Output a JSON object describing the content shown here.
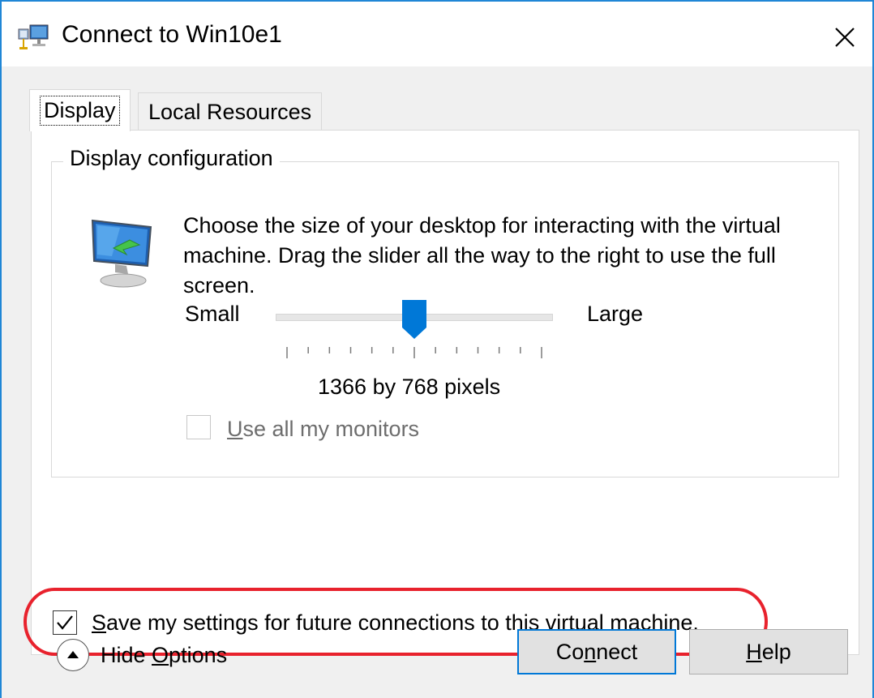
{
  "window": {
    "title": "Connect to Win10e1"
  },
  "tabs": [
    {
      "label": "Display",
      "selected": true
    },
    {
      "label": "Local Resources",
      "selected": false
    }
  ],
  "display_config": {
    "group_label": "Display configuration",
    "description": "Choose the size of your desktop for interacting with the virtual machine. Drag the slider all the way to the right to use the full screen.",
    "slider": {
      "min_label": "Small",
      "max_label": "Large",
      "tick_count": 13,
      "position": 0.53
    },
    "resolution_text": "1366 by 768 pixels",
    "use_all_monitors": {
      "label_prefix": "U",
      "label_rest": "se all my monitors",
      "checked": false,
      "enabled": false
    }
  },
  "save_settings": {
    "label_prefix": "S",
    "label_rest": "ave my settings for future connections to this virtual machine.",
    "checked": true
  },
  "hide_options": {
    "label_prefix": "Hide ",
    "label_underlined": "O",
    "label_rest": "ptions"
  },
  "buttons": {
    "connect": {
      "pre": "Co",
      "underlined": "n",
      "post": "nect"
    },
    "help": {
      "pre": "",
      "underlined": "H",
      "post": "elp"
    }
  },
  "colors": {
    "accent": "#0078d7",
    "highlight": "#e8222d",
    "window_border": "#1f86d6"
  }
}
